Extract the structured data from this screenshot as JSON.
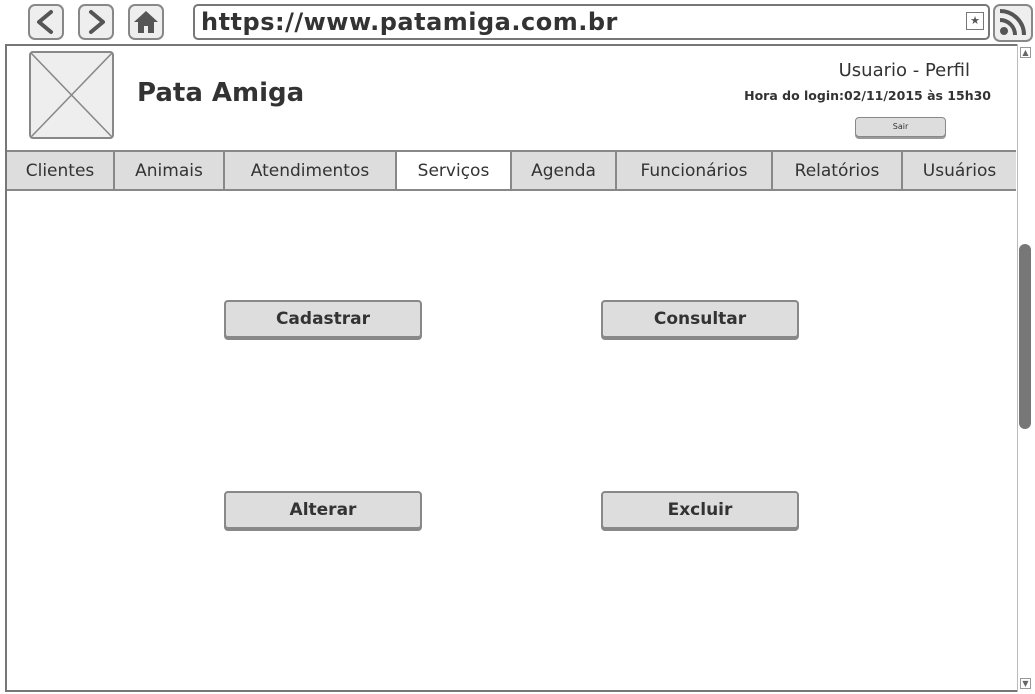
{
  "browser": {
    "url": "https://www.patamiga.com.br",
    "back_icon": "chevron-left-icon",
    "forward_icon": "chevron-right-icon",
    "home_icon": "home-icon",
    "bookmark_icon": "star-icon",
    "rss_icon": "rss-icon"
  },
  "header": {
    "site_title": "Pata Amiga",
    "user_profile": "Usuario - Perfil",
    "login_time": "Hora do login:02/11/2015 às 15h30",
    "logout_label": "Sair"
  },
  "tabs": [
    {
      "label": "Clientes",
      "active": false
    },
    {
      "label": "Animais",
      "active": false
    },
    {
      "label": "Atendimentos",
      "active": false
    },
    {
      "label": "Serviços",
      "active": true
    },
    {
      "label": "Agenda",
      "active": false
    },
    {
      "label": "Funcionários",
      "active": false
    },
    {
      "label": "Relatórios",
      "active": false
    },
    {
      "label": "Usuários",
      "active": false
    }
  ],
  "actions": {
    "register": "Cadastrar",
    "query": "Consultar",
    "edit": "Alterar",
    "delete": "Excluir"
  }
}
